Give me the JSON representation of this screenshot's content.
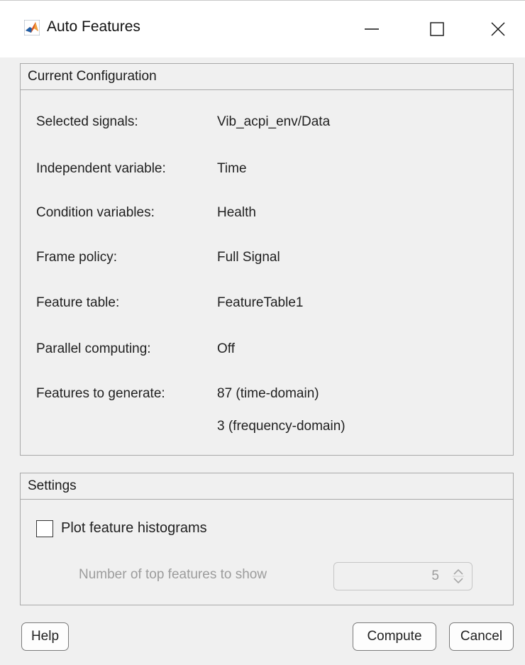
{
  "window": {
    "title": "Auto Features",
    "app_icon": "matlab-icon"
  },
  "config": {
    "header": "Current Configuration",
    "rows": [
      {
        "label": "Selected signals:",
        "value": "Vib_acpi_env/Data"
      },
      {
        "label": "Independent variable:",
        "value": "Time"
      },
      {
        "label": "Condition variables:",
        "value": "Health"
      },
      {
        "label": "Frame policy:",
        "value": "Full Signal"
      },
      {
        "label": "Feature table:",
        "value": "FeatureTable1"
      },
      {
        "label": "Parallel computing:",
        "value": "Off"
      },
      {
        "label": "Features to generate:",
        "value": "87 (time-domain)",
        "value2": "3 (frequency-domain)"
      }
    ]
  },
  "settings": {
    "header": "Settings",
    "plot_histograms_label": "Plot feature histograms",
    "plot_histograms_checked": false,
    "top_features_label": "Number of top features to show",
    "top_features_value": "5"
  },
  "buttons": {
    "help": "Help",
    "compute": "Compute",
    "cancel": "Cancel"
  }
}
